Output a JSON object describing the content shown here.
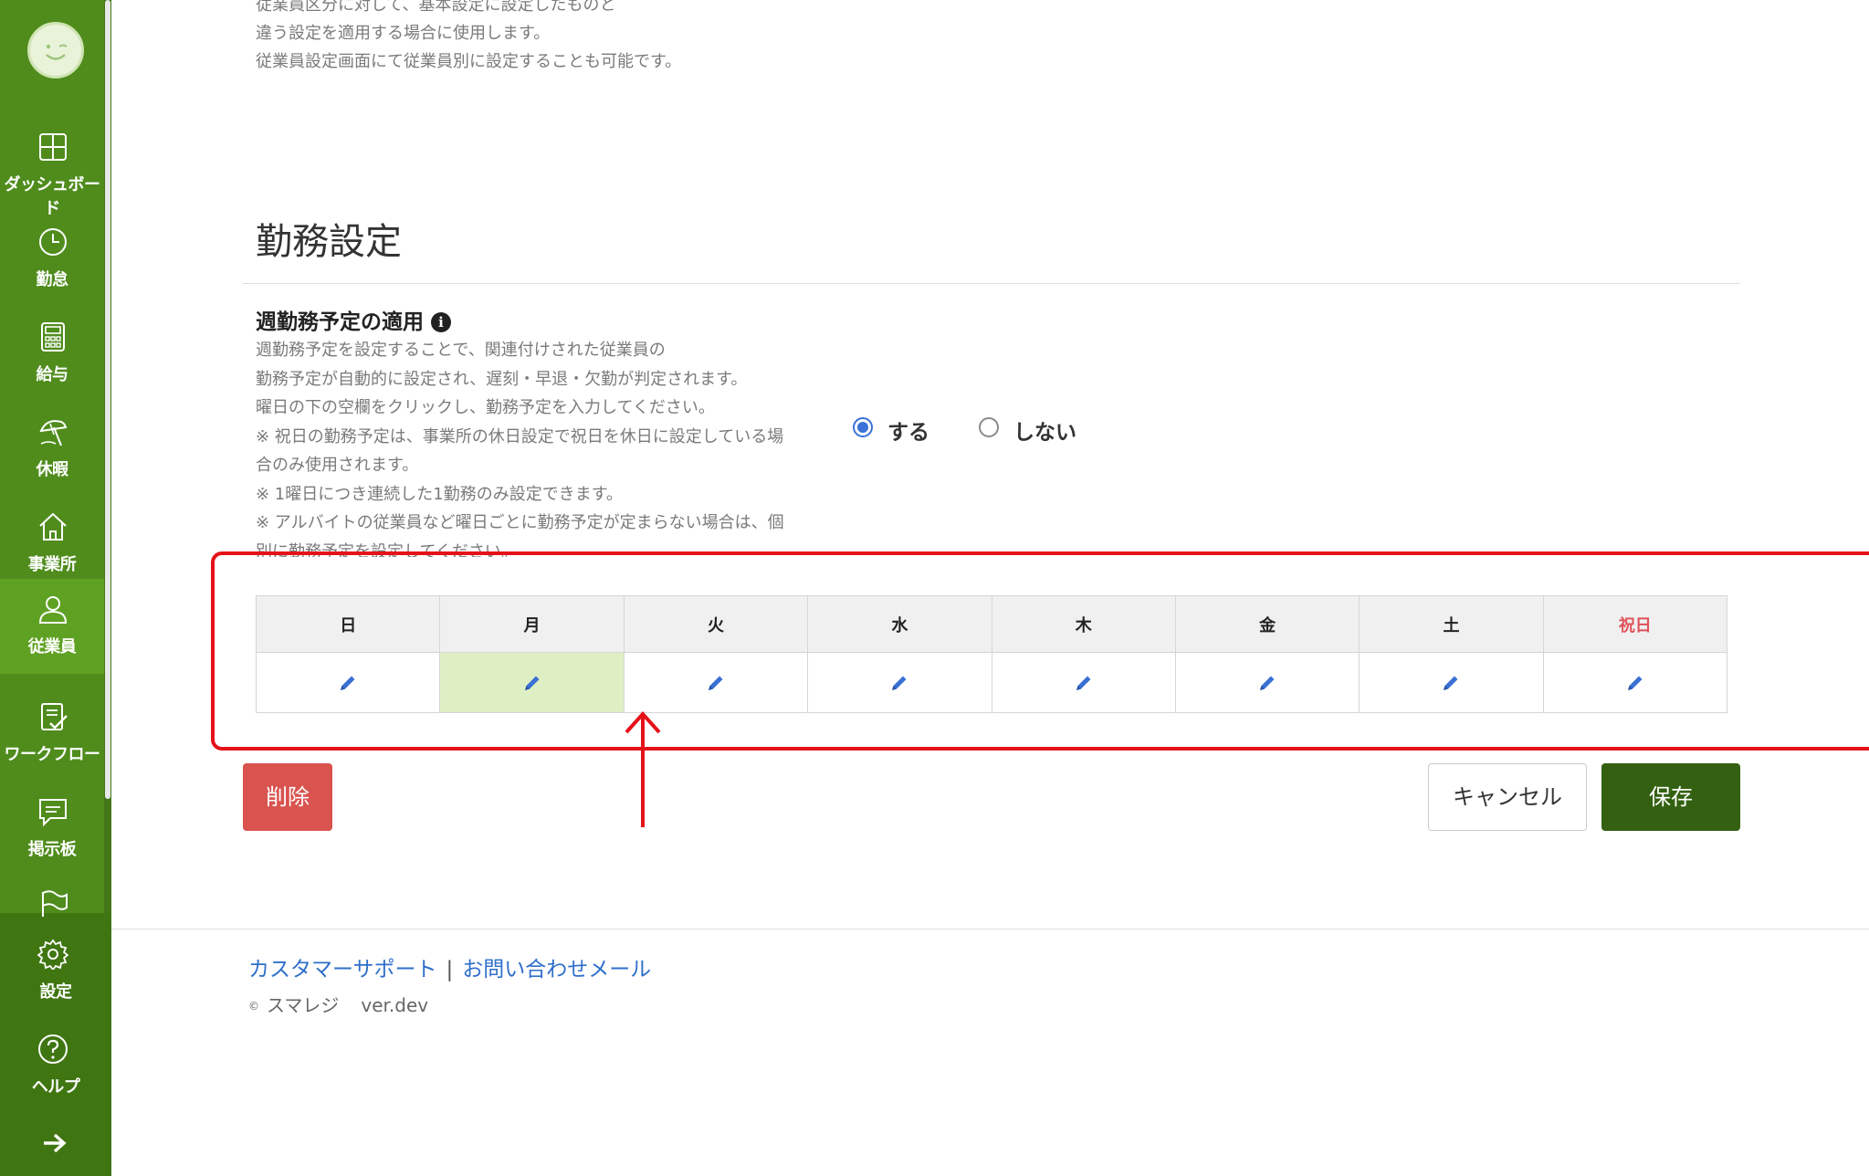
{
  "sidebar": {
    "items": [
      {
        "label": "ダッシュボード",
        "icon": "dashboard-icon"
      },
      {
        "label": "勤怠",
        "icon": "clock-icon"
      },
      {
        "label": "給与",
        "icon": "calculator-icon"
      },
      {
        "label": "休暇",
        "icon": "beach-umbrella-icon"
      },
      {
        "label": "事業所",
        "icon": "home-icon"
      },
      {
        "label": "従業員",
        "icon": "person-icon",
        "active": true
      },
      {
        "label": "ワークフロー",
        "icon": "checklist-icon"
      },
      {
        "label": "掲示板",
        "icon": "message-icon"
      },
      {
        "label": "",
        "icon": "flag-icon"
      }
    ],
    "bottom_items": [
      {
        "label": "設定",
        "icon": "gear-icon"
      },
      {
        "label": "ヘルプ",
        "icon": "question-icon"
      }
    ],
    "expand_icon": "arrow-right-icon",
    "colors": {
      "bg": "#4d8a1a",
      "active": "#5fa122",
      "bottom": "#3f7611"
    }
  },
  "top_description": [
    "従業員区分に対して、基本設定に設定したものと",
    "違う設定を適用する場合に使用します。",
    "従業員設定画面にて従業員別に設定することも可能です。"
  ],
  "section": {
    "title": "勤務設定",
    "field": {
      "title": "週勤務予定の適用",
      "info_icon": "i",
      "description": [
        "週勤務予定を設定することで、関連付けされた従業員の",
        "勤務予定が自動的に設定され、遅刻・早退・欠勤が判定されます。",
        "曜日の下の空欄をクリックし、勤務予定を入力してください。",
        "※ 祝日の勤務予定は、事業所の休日設定で祝日を休日に設定している場",
        "合のみ使用されます。",
        "※ 1曜日につき連続した1勤務のみ設定できます。",
        "※ アルバイトの従業員など曜日ごとに勤務予定が定まらない場合は、個",
        "別に勤務予定を設定してください。"
      ],
      "options": [
        {
          "label": "する",
          "checked": true
        },
        {
          "label": "しない",
          "checked": false
        }
      ]
    },
    "week_table": {
      "days": [
        "日",
        "月",
        "火",
        "水",
        "木",
        "金",
        "土",
        "祝日"
      ],
      "holiday_color": "#e0515a",
      "selected_day": "月",
      "edit_icon": "pencil-icon"
    }
  },
  "buttons": {
    "delete": "削除",
    "cancel": "キャンセル",
    "save": "保存"
  },
  "footer": {
    "support_link": "カスタマーサポート",
    "separator": "|",
    "mail_link": "お問い合わせメール",
    "copyright_symbol": "©",
    "company": "スマレジ",
    "version": "ver.dev"
  }
}
